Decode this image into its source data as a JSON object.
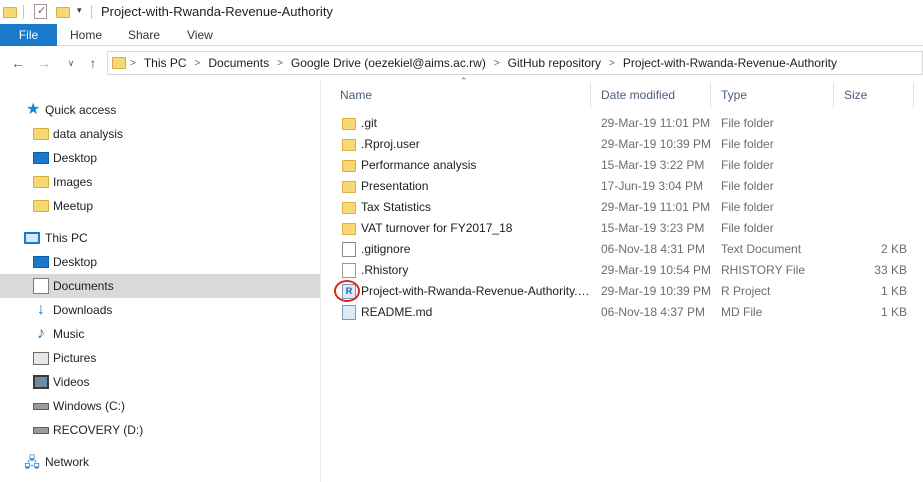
{
  "window": {
    "title": "Project-with-Rwanda-Revenue-Authority"
  },
  "ribbon": {
    "tabs": [
      "File",
      "Home",
      "Share",
      "View"
    ]
  },
  "address": {
    "crumbs": [
      "This PC",
      "Documents",
      "Google Drive (oezekiel@aims.ac.rw)",
      "GitHub repository",
      "Project-with-Rwanda-Revenue-Authority"
    ]
  },
  "nav": {
    "quick_access": "Quick access",
    "qa_items": [
      "data analysis",
      "Desktop",
      "Images",
      "Meetup"
    ],
    "this_pc": "This PC",
    "pc_items": [
      "Desktop",
      "Documents",
      "Downloads",
      "Music",
      "Pictures",
      "Videos",
      "Windows (C:)",
      "RECOVERY (D:)"
    ],
    "network": "Network"
  },
  "columns": {
    "name": "Name",
    "date": "Date modified",
    "type": "Type",
    "size": "Size"
  },
  "files": [
    {
      "name": ".git",
      "date": "29-Mar-19 11:01 PM",
      "type": "File folder",
      "size": ""
    },
    {
      "name": ".Rproj.user",
      "date": "29-Mar-19 10:39 PM",
      "type": "File folder",
      "size": ""
    },
    {
      "name": "Performance analysis",
      "date": "15-Mar-19 3:22 PM",
      "type": "File folder",
      "size": ""
    },
    {
      "name": "Presentation",
      "date": "17-Jun-19 3:04 PM",
      "type": "File folder",
      "size": ""
    },
    {
      "name": "Tax Statistics",
      "date": "29-Mar-19 11:01 PM",
      "type": "File folder",
      "size": ""
    },
    {
      "name": "VAT turnover for FY2017_18",
      "date": "15-Mar-19 3:23 PM",
      "type": "File folder",
      "size": ""
    },
    {
      "name": ".gitignore",
      "date": "06-Nov-18 4:31 PM",
      "type": "Text Document",
      "size": "2 KB"
    },
    {
      "name": ".Rhistory",
      "date": "29-Mar-19 10:54 PM",
      "type": "RHISTORY File",
      "size": "33 KB"
    },
    {
      "name": "Project-with-Rwanda-Revenue-Authority.Rproj",
      "date": "29-Mar-19 10:39 PM",
      "type": "R Project",
      "size": "1 KB"
    },
    {
      "name": "README.md",
      "date": "06-Nov-18 4:37 PM",
      "type": "MD File",
      "size": "1 KB"
    }
  ],
  "icons": {
    "quick_access": "star-icon",
    "this_pc": "computer-icon",
    "network": "network-icon",
    "folder": "folder-icon",
    "text_file": "text-file-icon",
    "rproj_file": "rproject-icon",
    "md_file": "md-file-icon"
  },
  "colors": {
    "file_tab": "#1979ca",
    "selected_nav": "#d9d9d9",
    "annotation": "#e3231b",
    "folder": "#f8d775"
  }
}
